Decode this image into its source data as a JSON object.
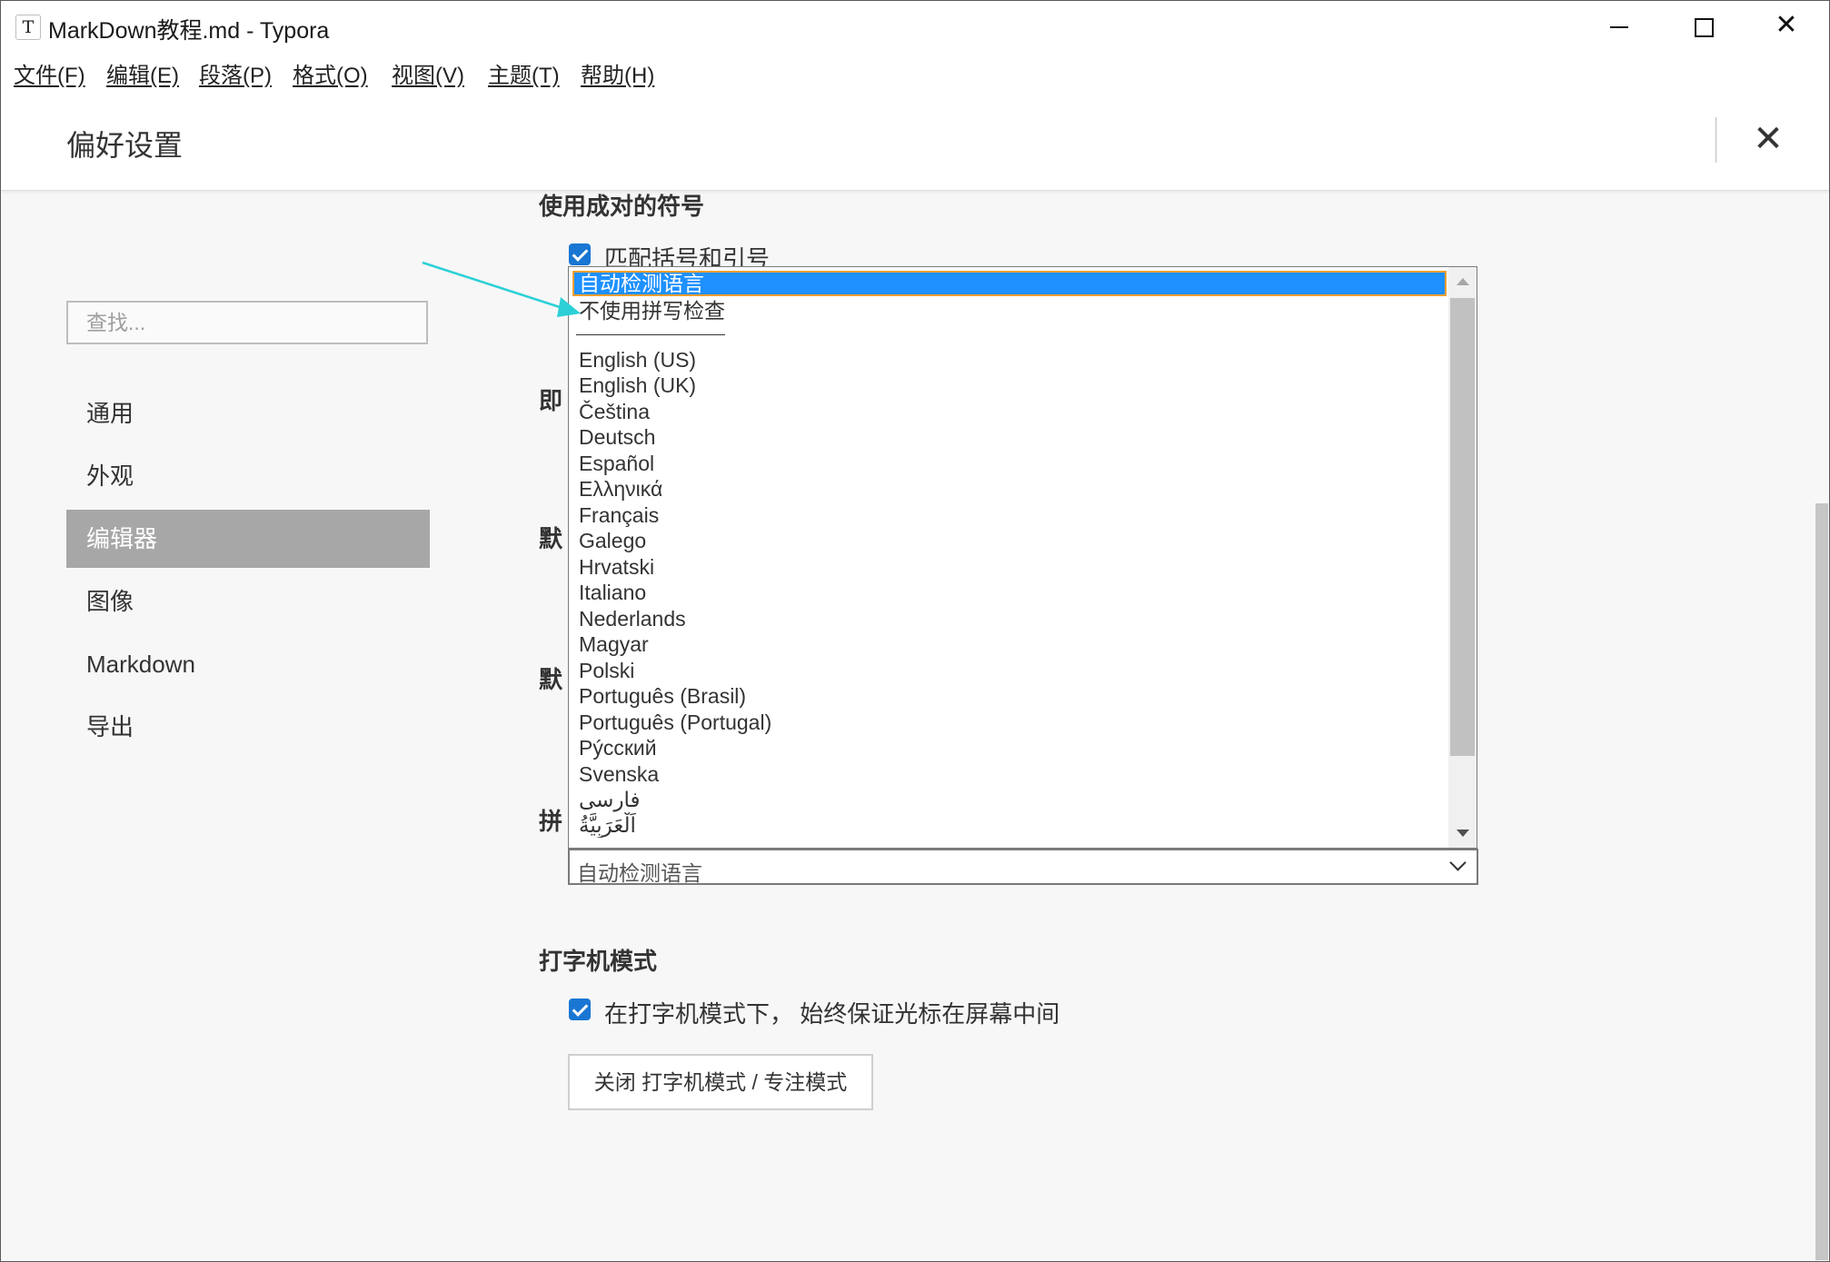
{
  "window": {
    "app_icon_letter": "T",
    "title": "MarkDown教程.md - Typora",
    "minimize_glyph": "—",
    "close_glyph": "✕"
  },
  "menu": [
    "文件(F)",
    "编辑(E)",
    "段落(P)",
    "格式(O)",
    "视图(V)",
    "主题(T)",
    "帮助(H)"
  ],
  "preferences": {
    "title": "偏好设置",
    "close_glyph": "✕"
  },
  "sidebar": {
    "search_placeholder": "查找...",
    "items": [
      {
        "label": "通用",
        "active": false
      },
      {
        "label": "外观",
        "active": false
      },
      {
        "label": "编辑器",
        "active": true
      },
      {
        "label": "图像",
        "active": false
      },
      {
        "label": "Markdown",
        "active": false
      },
      {
        "label": "导出",
        "active": false
      }
    ]
  },
  "content": {
    "pairs_section": {
      "title": "使用成对的符号",
      "checkbox_label": "匹配括号和引号",
      "checked": true
    },
    "hidden_sections": [
      "即",
      "默",
      "默",
      "拼"
    ],
    "spellcheck": {
      "selected_value": "自动检测语言",
      "options": [
        "自动检测语言",
        "不使用拼写检查",
        "English (US)",
        "English (UK)",
        "Čeština",
        "Deutsch",
        "Español",
        "Ελληνικά",
        "Français",
        "Galego",
        "Hrvatski",
        "Italiano",
        "Nederlands",
        "Magyar",
        "Polski",
        "Português (Brasil)",
        "Português (Portugal)",
        "Рýсский",
        "Svenska",
        "فارسی",
        "اَلْعَرَبِيَّةُ"
      ],
      "highlighted_index": 0
    },
    "typewriter": {
      "title": "打字机模式",
      "checkbox_label": "在打字机模式下， 始终保证光标在屏幕中间",
      "checked": true,
      "button_label": "关闭 打字机模式 / 专注模式"
    }
  },
  "colors": {
    "selection": "#1e90ff",
    "focus_outline": "#f0a030",
    "checkbox": "#1976d2",
    "sidebar_active": "#a7a7a7",
    "annotation_arrow": "#2bd0d6"
  }
}
